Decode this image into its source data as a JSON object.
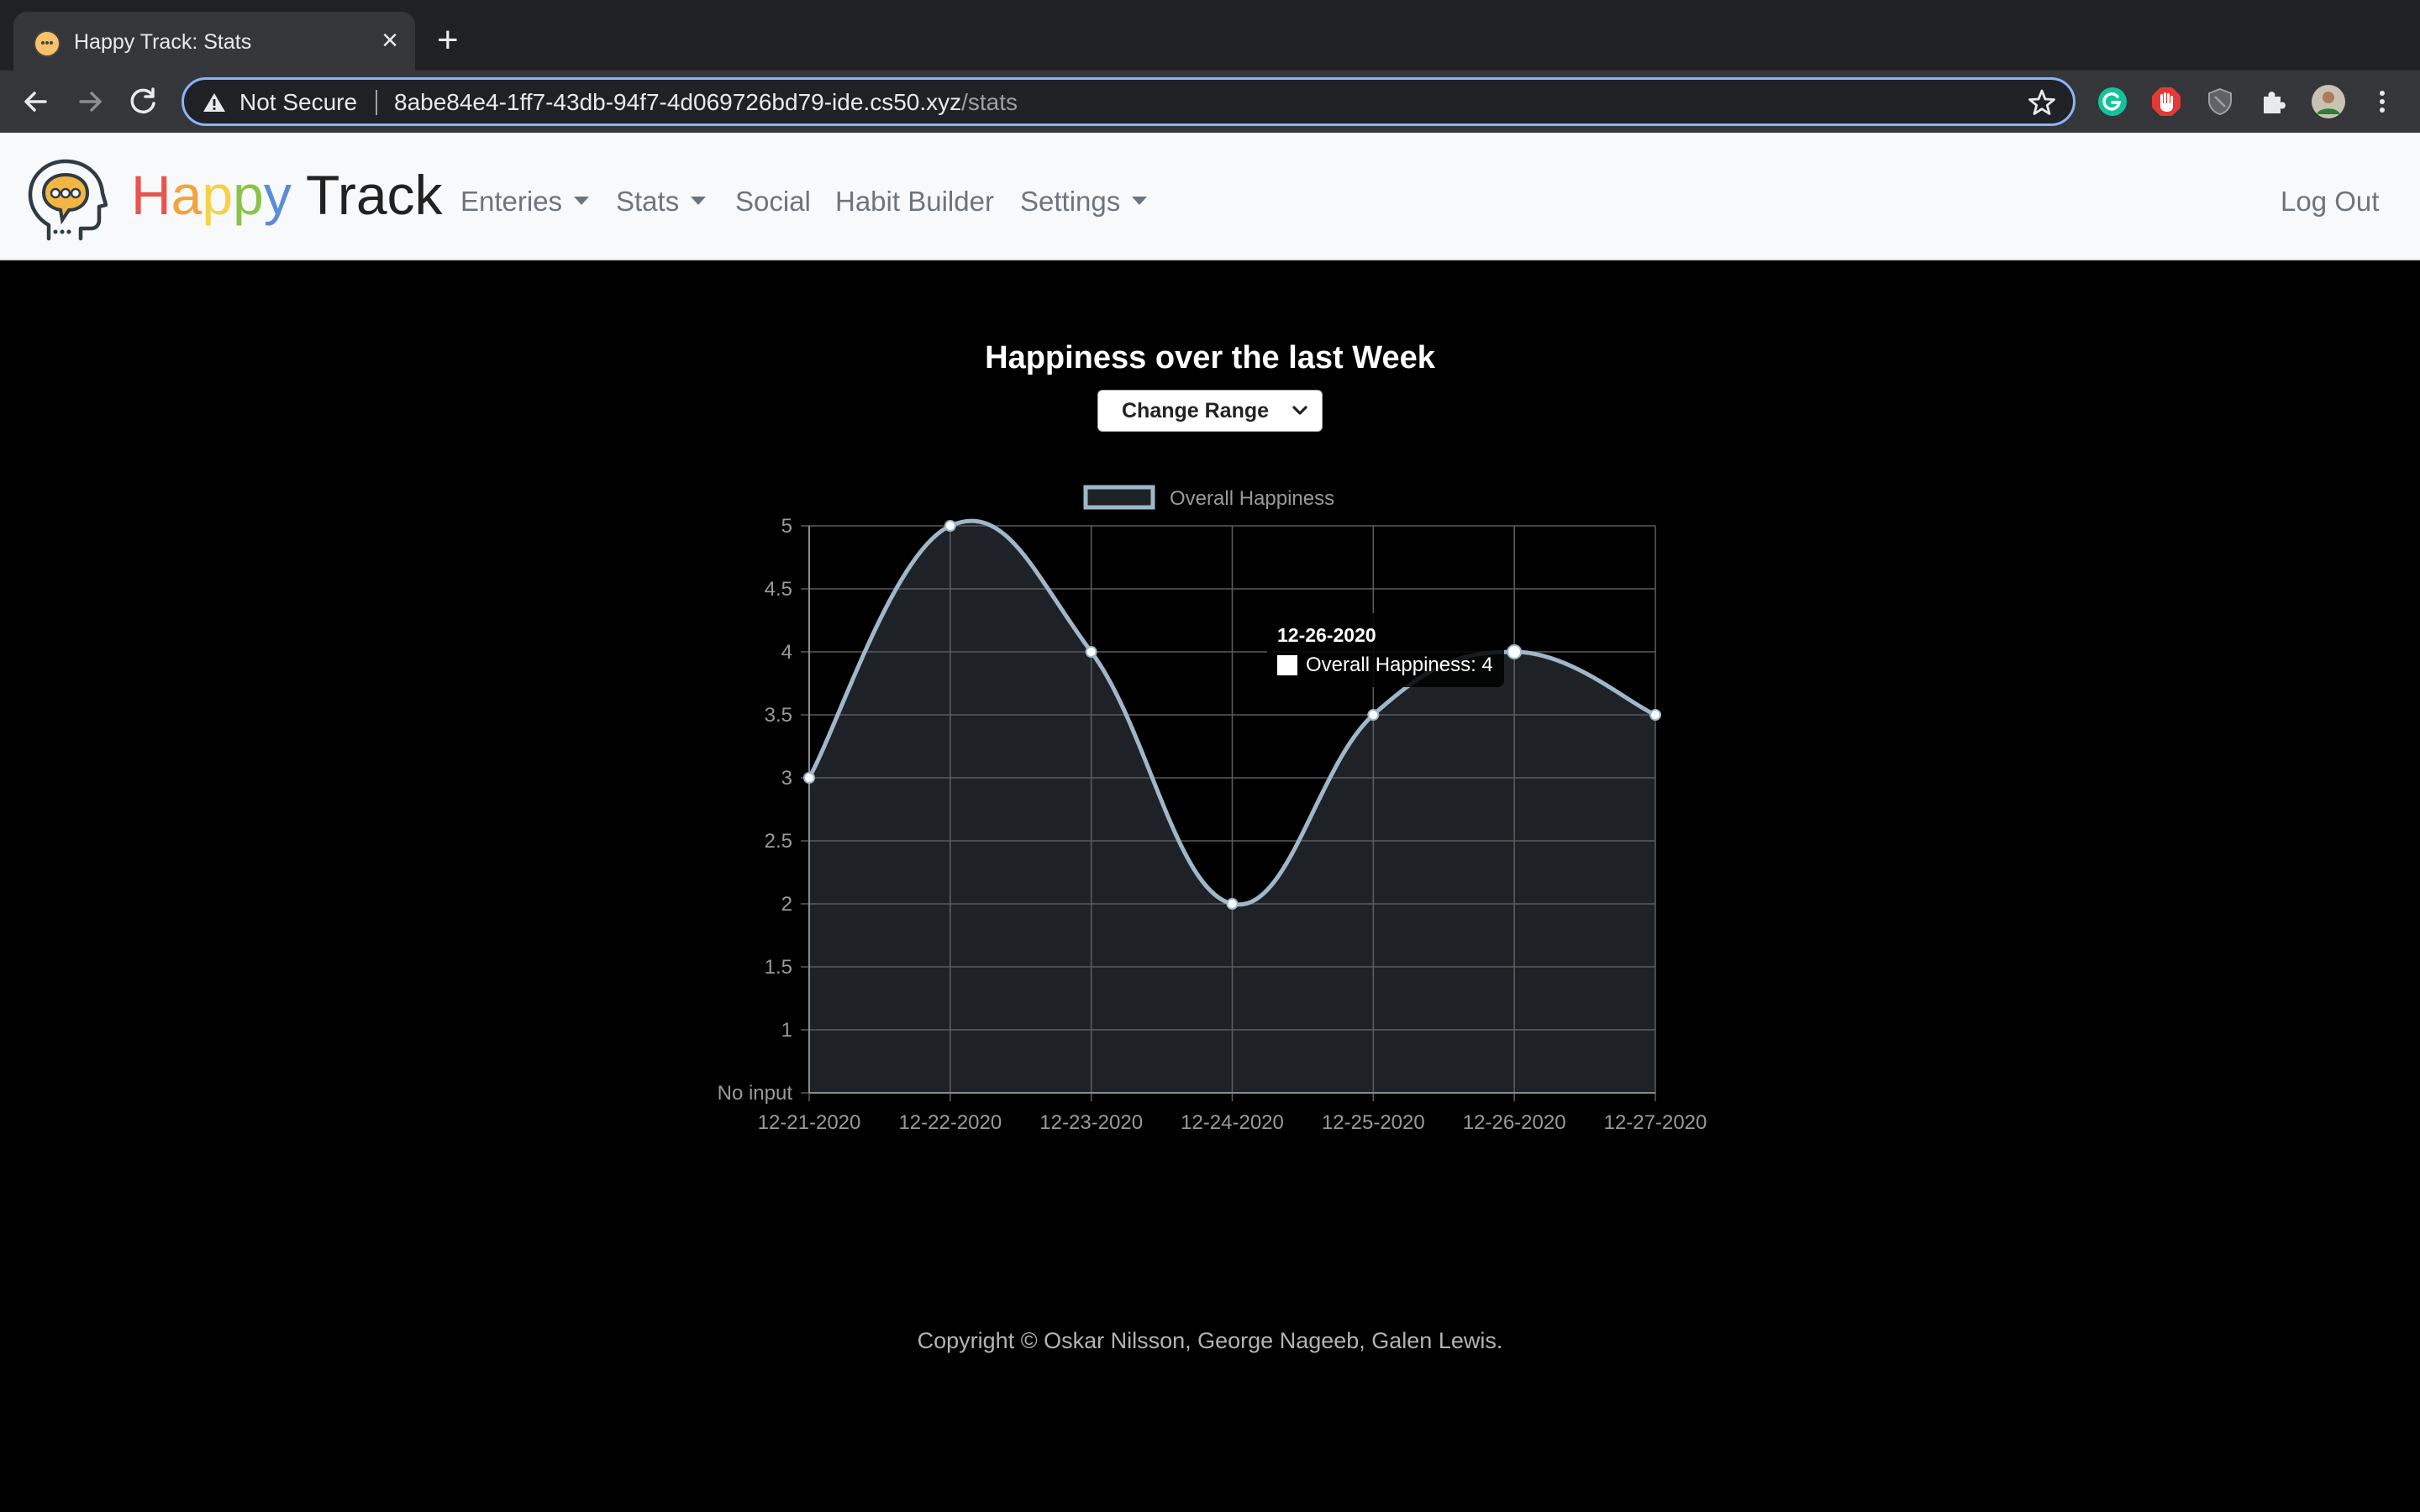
{
  "browser": {
    "tab_title": "Happy Track: Stats",
    "tab_close_icon": "close-icon",
    "new_tab_icon": "plus-icon",
    "security_label": "Not Secure",
    "url_host": "8abe84e4-1ff7-43db-94f7-4d069726bd79-ide.cs50.xyz",
    "url_path": "/stats",
    "accent": "#8ab4f8"
  },
  "navbar": {
    "brand_letters": [
      "H",
      "a",
      "p",
      "p",
      "y"
    ],
    "brand_colors": [
      "#e8554e",
      "#f2a33a",
      "#f7d046",
      "#8bc34a",
      "#5b8dd6"
    ],
    "brand_rest": " Track",
    "items": [
      {
        "label": "Enteries",
        "dropdown": true
      },
      {
        "label": "Stats",
        "dropdown": true
      },
      {
        "label": "Social",
        "dropdown": false
      },
      {
        "label": "Habit Builder",
        "dropdown": false
      },
      {
        "label": "Settings",
        "dropdown": true
      }
    ],
    "logout": "Log Out"
  },
  "page": {
    "heading": "Happiness over the last Week",
    "range_select": "Change Range"
  },
  "chart_data": {
    "type": "line",
    "x": [
      "12-21-2020",
      "12-22-2020",
      "12-23-2020",
      "12-24-2020",
      "12-25-2020",
      "12-26-2020",
      "12-27-2020"
    ],
    "series": [
      {
        "name": "Overall Happiness",
        "values": [
          3,
          5,
          4,
          2,
          3.5,
          4,
          3.5
        ],
        "color": "#9fb7c9"
      }
    ],
    "y_ticks": [
      "No input",
      "1",
      "1.5",
      "2",
      "2.5",
      "3",
      "3.5",
      "4",
      "4.5",
      "5"
    ],
    "ylim": [
      0.5,
      5
    ],
    "grid": true,
    "legend": "top",
    "tooltip": {
      "title": "12-26-2020",
      "body": "Overall Happiness: 4"
    }
  },
  "footer": {
    "copyright": "Copyright © Oskar Nilsson, George Nageeb, Galen Lewis."
  }
}
